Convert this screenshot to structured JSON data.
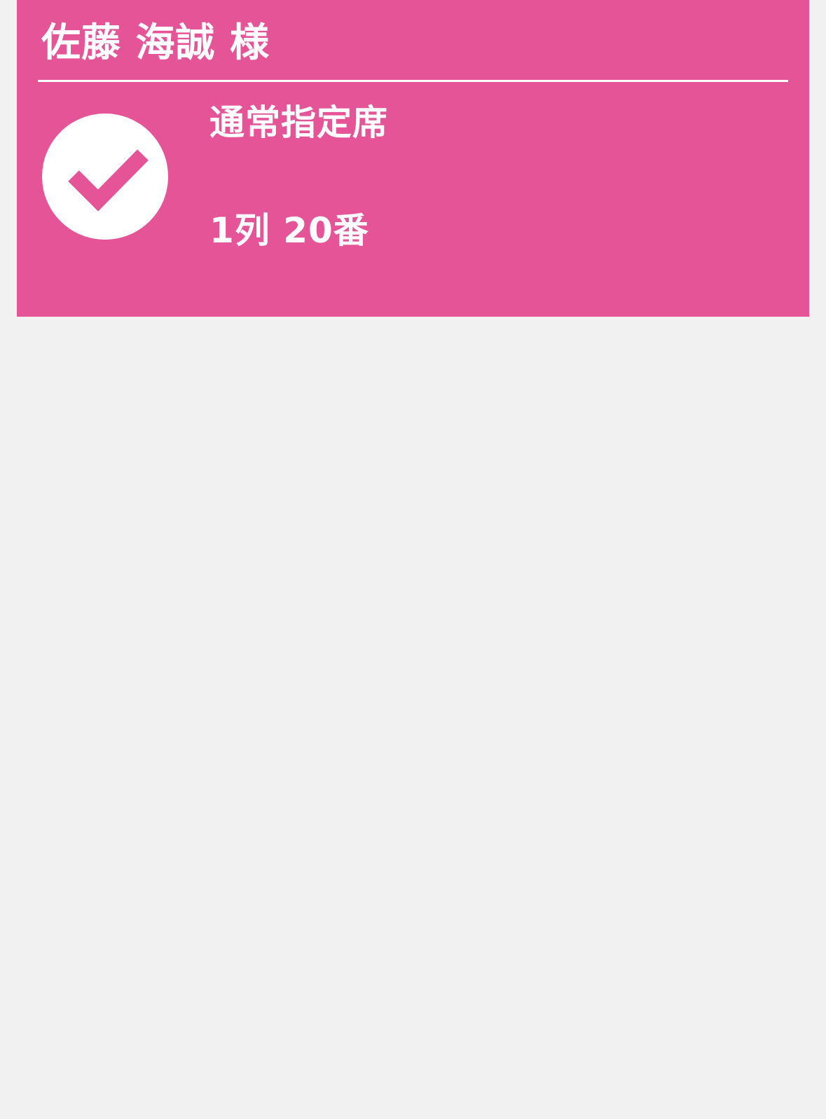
{
  "ticket": {
    "holder_name": "佐藤 海誠 様",
    "seat_type": "通常指定席",
    "seat_number": "1列 20番",
    "status_icon": "check-icon"
  },
  "colors": {
    "card_background": "#e65498",
    "page_background": "#f2f1f2",
    "text": "#ffffff",
    "check_mark": "#e65498"
  }
}
